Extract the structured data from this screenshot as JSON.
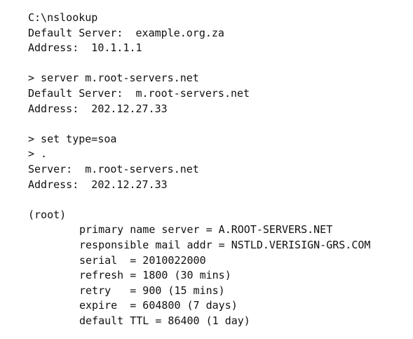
{
  "session": {
    "command_nslookup": "C:\\nslookup",
    "default_server_1": "Default Server:  example.org.za",
    "address_1": "Address:  10.1.1.1",
    "command_server": "> server m.root-servers.net",
    "default_server_2": "Default Server:  m.root-servers.net",
    "address_2": "Address:  202.12.27.33",
    "command_set_type": "> set type=soa",
    "command_query": "> .",
    "server": "Server:  m.root-servers.net",
    "address_3": "Address:  202.12.27.33",
    "zone": "(root)",
    "soa_record": {
      "primary_name_server": "primary name server = A.ROOT-SERVERS.NET",
      "responsible_mail_addr": "responsible mail addr = NSTLD.VERISIGN-GRS.COM",
      "serial": "serial  = 2010022000",
      "refresh": "refresh = 1800 (30 mins)",
      "retry": "retry   = 900 (15 mins)",
      "expire": "expire  = 604800 (7 days)",
      "default_ttl": "default TTL = 86400 (1 day)"
    }
  }
}
